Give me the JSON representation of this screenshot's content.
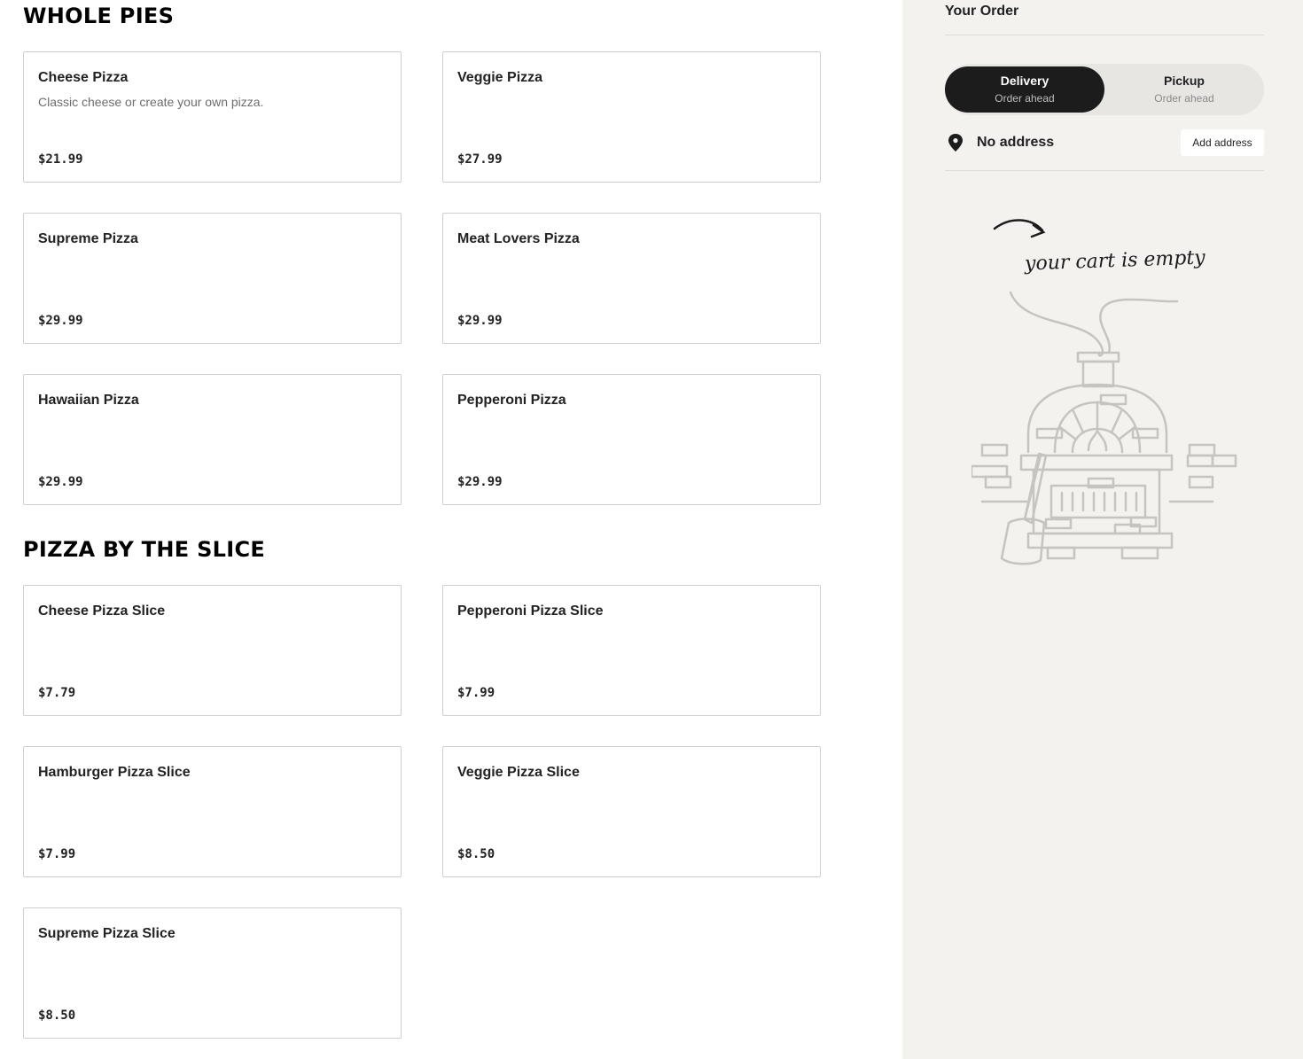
{
  "menu": {
    "sections": [
      {
        "title": "WHOLE PIES",
        "items": [
          {
            "name": "Cheese Pizza",
            "description": "Classic cheese or create your own pizza.",
            "price": "$21.99"
          },
          {
            "name": "Veggie Pizza",
            "price": "$27.99"
          },
          {
            "name": "Supreme Pizza",
            "price": "$29.99"
          },
          {
            "name": "Meat Lovers Pizza",
            "price": "$29.99"
          },
          {
            "name": "Hawaiian Pizza",
            "price": "$29.99"
          },
          {
            "name": "Pepperoni Pizza",
            "price": "$29.99"
          }
        ]
      },
      {
        "title": "PIZZA BY THE SLICE",
        "items": [
          {
            "name": "Cheese Pizza Slice",
            "price": "$7.79"
          },
          {
            "name": "Pepperoni Pizza Slice",
            "price": "$7.99"
          },
          {
            "name": "Hamburger Pizza Slice",
            "price": "$7.99"
          },
          {
            "name": "Veggie Pizza Slice",
            "price": "$8.50"
          },
          {
            "name": "Supreme Pizza Slice",
            "price": "$8.50"
          }
        ]
      }
    ]
  },
  "order": {
    "title": "Your Order",
    "modes": [
      {
        "label": "Delivery",
        "sublabel": "Order ahead",
        "selected": true
      },
      {
        "label": "Pickup",
        "sublabel": "Order ahead",
        "selected": false
      }
    ],
    "address": {
      "icon": "location-pin-icon",
      "text": "No address",
      "button_label": "Add address"
    },
    "empty_message": "your cart is empty",
    "illustration": "pizza-oven-illustration"
  },
  "colors": {
    "accent_dark": "#1c1c1c",
    "sidebar_bg": "#f3f2ef",
    "card_border": "#cfcfcf",
    "illustration_stroke": "#c6c4bf"
  }
}
